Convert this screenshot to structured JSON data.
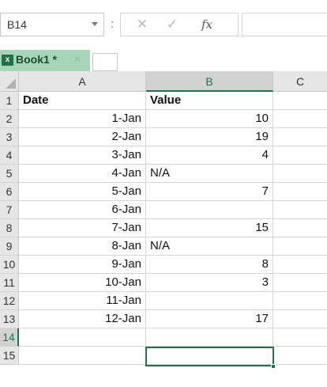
{
  "formula_bar": {
    "name_box": "B14",
    "cancel_glyph": "✕",
    "enter_glyph": "✓",
    "fx_label": "fx",
    "formula_value": ""
  },
  "workbook_tab": {
    "title": "Book1 *",
    "close_glyph": "×",
    "icon_letter": "x"
  },
  "grid": {
    "columns": [
      "A",
      "B",
      "C"
    ],
    "selected_column": "B",
    "selected_row": "14",
    "rows": [
      {
        "n": "1",
        "a": "Date",
        "b": "Value"
      },
      {
        "n": "2",
        "a": "1-Jan",
        "b": "10"
      },
      {
        "n": "3",
        "a": "2-Jan",
        "b": "19"
      },
      {
        "n": "4",
        "a": "3-Jan",
        "b": "4"
      },
      {
        "n": "5",
        "a": "4-Jan",
        "b": "N/A"
      },
      {
        "n": "6",
        "a": "5-Jan",
        "b": "7"
      },
      {
        "n": "7",
        "a": "6-Jan",
        "b": ""
      },
      {
        "n": "8",
        "a": "7-Jan",
        "b": "15"
      },
      {
        "n": "9",
        "a": "8-Jan",
        "b": "N/A"
      },
      {
        "n": "10",
        "a": "9-Jan",
        "b": "8"
      },
      {
        "n": "11",
        "a": "10-Jan",
        "b": "3"
      },
      {
        "n": "12",
        "a": "11-Jan",
        "b": ""
      },
      {
        "n": "13",
        "a": "12-Jan",
        "b": "17"
      },
      {
        "n": "14",
        "a": "",
        "b": ""
      },
      {
        "n": "15",
        "a": "",
        "b": ""
      }
    ]
  },
  "colors": {
    "accent": "#217346",
    "tab_background": "#a8d4b8",
    "header_background": "#e6e6e6"
  }
}
